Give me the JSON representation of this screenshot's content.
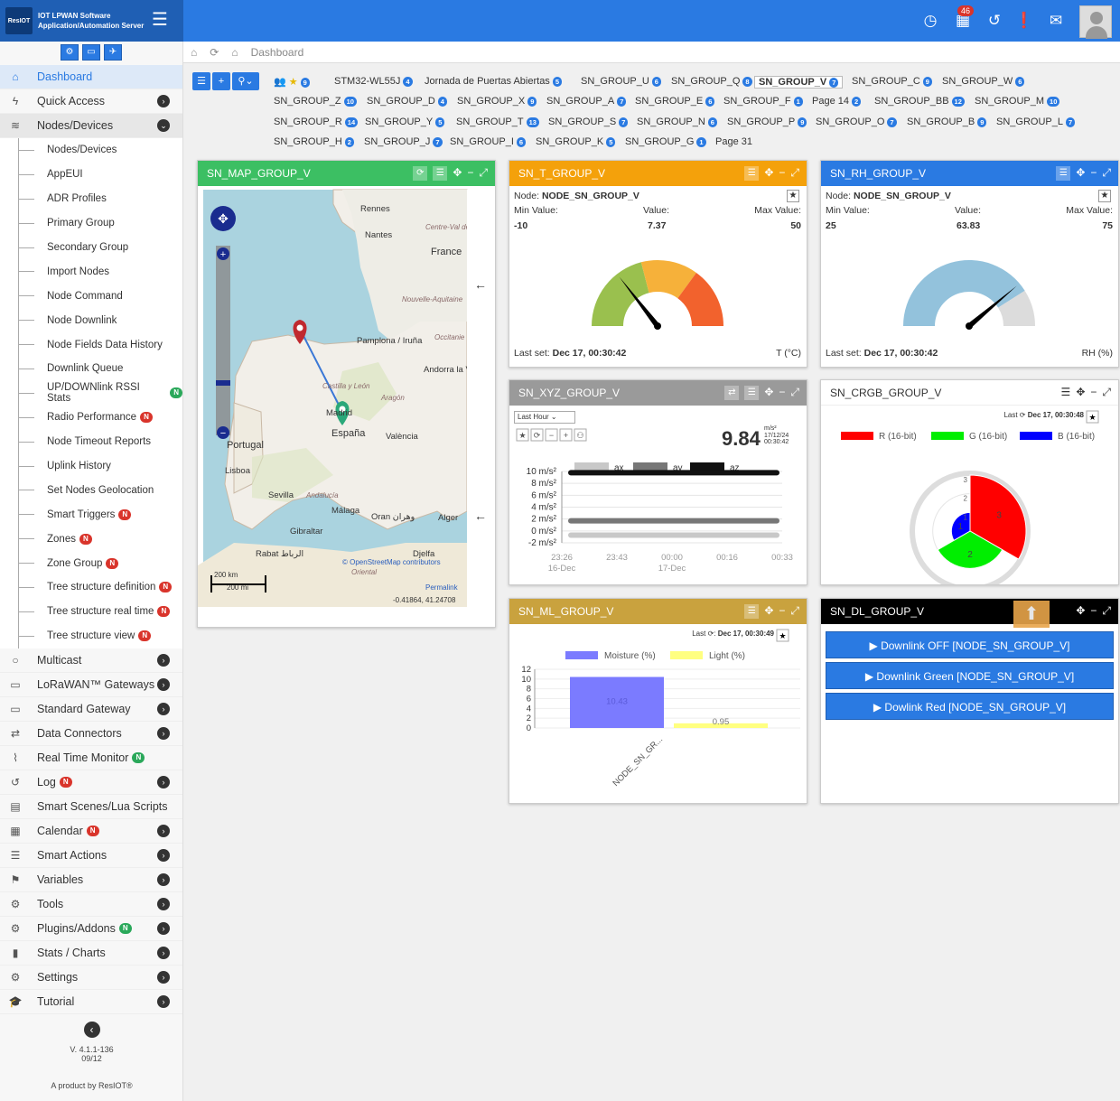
{
  "app": {
    "logo_mark": "ResIOT",
    "logo_text": "IOT LPWAN Software Application/Automation Server",
    "notifications_count": "46"
  },
  "breadcrumb": {
    "home": "Dashboard"
  },
  "sidebar": {
    "items": [
      {
        "label": "Dashboard",
        "icon": "home-icon"
      },
      {
        "label": "Quick Access",
        "icon": "bolt-icon"
      },
      {
        "label": "Nodes/Devices",
        "icon": "rss-icon"
      }
    ],
    "sub_items": [
      {
        "label": "Nodes/Devices",
        "badge": ""
      },
      {
        "label": "AppEUI",
        "badge": ""
      },
      {
        "label": "ADR Profiles",
        "badge": ""
      },
      {
        "label": "Primary Group",
        "badge": ""
      },
      {
        "label": "Secondary Group",
        "badge": ""
      },
      {
        "label": "Import Nodes",
        "badge": ""
      },
      {
        "label": "Node Command",
        "badge": ""
      },
      {
        "label": "Node Downlink",
        "badge": ""
      },
      {
        "label": "Node Fields Data History",
        "badge": ""
      },
      {
        "label": "Downlink Queue",
        "badge": ""
      },
      {
        "label": "UP/DOWNlink RSSI Stats",
        "badge": "N",
        "badge_color": "g"
      },
      {
        "label": "Radio Performance",
        "badge": "N",
        "badge_color": "r"
      },
      {
        "label": "Node Timeout Reports",
        "badge": ""
      },
      {
        "label": "Uplink History",
        "badge": ""
      },
      {
        "label": "Set Nodes Geolocation",
        "badge": ""
      },
      {
        "label": "Smart Triggers",
        "badge": "N",
        "badge_color": "r"
      },
      {
        "label": "Zones",
        "badge": "N",
        "badge_color": "r"
      },
      {
        "label": "Zone Group",
        "badge": "N",
        "badge_color": "r"
      },
      {
        "label": "Tree structure definition",
        "badge": "N",
        "badge_color": "r"
      },
      {
        "label": "Tree structure real time",
        "badge": "N",
        "badge_color": "r"
      },
      {
        "label": "Tree structure view",
        "badge": "N",
        "badge_color": "r"
      }
    ],
    "lower_items": [
      {
        "label": "Multicast",
        "badge": "",
        "arrow": true
      },
      {
        "label": "LoRaWAN™ Gateways",
        "badge": "",
        "arrow": true
      },
      {
        "label": "Standard Gateway",
        "badge": "",
        "arrow": true
      },
      {
        "label": "Data Connectors",
        "badge": "",
        "arrow": true
      },
      {
        "label": "Real Time Monitor",
        "badge": "N",
        "badge_color": "g",
        "arrow": false
      },
      {
        "label": "Log",
        "badge": "N",
        "badge_color": "r",
        "arrow": true
      },
      {
        "label": "Smart Scenes/Lua Scripts",
        "badge": "",
        "arrow": false
      },
      {
        "label": "Calendar",
        "badge": "N",
        "badge_color": "r",
        "arrow": true
      },
      {
        "label": "Smart Actions",
        "badge": "",
        "arrow": true
      },
      {
        "label": "Variables",
        "badge": "",
        "arrow": true
      },
      {
        "label": "Tools",
        "badge": "",
        "arrow": true
      },
      {
        "label": "Plugins/Addons",
        "badge": "N",
        "badge_color": "g",
        "arrow": true
      },
      {
        "label": "Stats / Charts",
        "badge": "",
        "arrow": true
      },
      {
        "label": "Settings",
        "badge": "",
        "arrow": true
      },
      {
        "label": "Tutorial",
        "badge": "",
        "arrow": true
      }
    ],
    "version": "V. 4.1.1-136",
    "version_date": "09/12",
    "product_by": "A product by ResIOT®"
  },
  "groups": {
    "star_count": "9",
    "rows": [
      [
        {
          "l": "STM32-WL55J",
          "n": "4"
        },
        {
          "l": "Jornada de Puertas Abiertas",
          "n": "5"
        },
        {
          "l": "SN_GROUP_U",
          "n": "6"
        },
        {
          "l": "SN_GROUP_Q",
          "n": "8"
        },
        {
          "l": "SN_GROUP_V",
          "n": "7",
          "sel": true
        },
        {
          "l": "SN_GROUP_C",
          "n": "9"
        },
        {
          "l": "SN_GROUP_W",
          "n": "6"
        }
      ],
      [
        {
          "l": "SN_GROUP_Z",
          "n": "10"
        },
        {
          "l": "SN_GROUP_D",
          "n": "4"
        },
        {
          "l": "SN_GROUP_X",
          "n": "9"
        },
        {
          "l": "SN_GROUP_A",
          "n": "7"
        },
        {
          "l": "SN_GROUP_E",
          "n": "6"
        },
        {
          "l": "SN_GROUP_F",
          "n": "1"
        },
        {
          "l": "Page 14",
          "n": "2"
        },
        {
          "l": "SN_GROUP_BB",
          "n": "12"
        },
        {
          "l": "SN_GROUP_M",
          "n": "10"
        }
      ],
      [
        {
          "l": "SN_GROUP_R",
          "n": "14"
        },
        {
          "l": "SN_GROUP_Y",
          "n": "5"
        },
        {
          "l": "SN_GROUP_T",
          "n": "13"
        },
        {
          "l": "SN_GROUP_S",
          "n": "7"
        },
        {
          "l": "SN_GROUP_N",
          "n": "6"
        },
        {
          "l": "SN_GROUP_P",
          "n": "9"
        },
        {
          "l": "SN_GROUP_O",
          "n": "7"
        },
        {
          "l": "SN_GROUP_B",
          "n": "9"
        },
        {
          "l": "SN_GROUP_L",
          "n": "7"
        }
      ],
      [
        {
          "l": "SN_GROUP_H",
          "n": "2"
        },
        {
          "l": "SN_GROUP_J",
          "n": "7"
        },
        {
          "l": "SN_GROUP_I",
          "n": "6"
        },
        {
          "l": "SN_GROUP_K",
          "n": "5"
        },
        {
          "l": "SN_GROUP_G",
          "n": "1"
        },
        {
          "l": "Page 31",
          "n": ""
        }
      ]
    ]
  },
  "map": {
    "title": "SN_MAP_GROUP_V",
    "scale_km": "200 km",
    "scale_mi": "200 mi",
    "coords": "-0.41864, 41.24708",
    "attribution": "© OpenStreetMap contributors",
    "permalink": "Permalink",
    "places": [
      {
        "t": "Rennes"
      },
      {
        "t": "Nantes"
      },
      {
        "t": "France"
      },
      {
        "t": "Centre-Val de Loire"
      },
      {
        "t": "Nouvelle-Aquitaine"
      },
      {
        "t": "Occitanie"
      },
      {
        "t": "Pamplona / Iruña"
      },
      {
        "t": "Andorra la Vella"
      },
      {
        "t": "Aragón"
      },
      {
        "t": "Castilla y León"
      },
      {
        "t": "Madrid"
      },
      {
        "t": "España"
      },
      {
        "t": "València"
      },
      {
        "t": "Portugal"
      },
      {
        "t": "Lisboa"
      },
      {
        "t": "Sevilla"
      },
      {
        "t": "Andalucía"
      },
      {
        "t": "Málaga"
      },
      {
        "t": "Gibraltar"
      },
      {
        "t": "Oran وهران"
      },
      {
        "t": "Alger"
      },
      {
        "t": "Rabat الرباط"
      },
      {
        "t": "Djelfa"
      },
      {
        "t": "Oriental"
      }
    ]
  },
  "t_gauge": {
    "title": "SN_T_GROUP_V",
    "node_label": "Node:",
    "node": "NODE_SN_GROUP_V",
    "min_label": "Min Value:",
    "value_label": "Value:",
    "max_label": "Max Value:",
    "min": "-10",
    "value": "7.37",
    "max": "50",
    "last_set_label": "Last set:",
    "last_set": "Dec 17, 00:30:42",
    "unit": "T (°C)",
    "value_num": 7.37,
    "min_num": -10,
    "max_num": 50
  },
  "rh_gauge": {
    "title": "SN_RH_GROUP_V",
    "node_label": "Node:",
    "node": "NODE_SN_GROUP_V",
    "min_label": "Min Value:",
    "value_label": "Value:",
    "max_label": "Max Value:",
    "min": "25",
    "value": "63.83",
    "max": "75",
    "last_set_label": "Last set:",
    "last_set": "Dec 17, 00:30:42",
    "unit": "RH (%)",
    "value_num": 63.83,
    "min_num": 25,
    "max_num": 75
  },
  "xyz": {
    "title": "SN_XYZ_GROUP_V",
    "range": "Last Hour",
    "value": "9.84",
    "unit": "m/s²",
    "date": "17/12/24",
    "time": "00:30:42"
  },
  "crgb": {
    "title": "SN_CRGB_GROUP_V",
    "last_label": "Last",
    "last": "Dec 17, 00:30:48"
  },
  "ml": {
    "title": "SN_ML_GROUP_V",
    "last_label": "Last",
    "last": "Dec 17, 00:30:49"
  },
  "dl": {
    "title": "SN_DL_GROUP_V",
    "buttons": [
      "Downlink OFF [NODE_SN_GROUP_V]",
      "Downlink Green [NODE_SN_GROUP_V]",
      "Dowlink Red [NODE_SN_GROUP_V]"
    ]
  },
  "chart_data": [
    {
      "type": "line",
      "title": "SN_XYZ_GROUP_V",
      "ylabel": "",
      "yticks": [
        "10 m/s²",
        "8 m/s²",
        "6 m/s²",
        "4 m/s²",
        "2 m/s²",
        "0 m/s²",
        "-2 m/s²"
      ],
      "ylim": [
        -2,
        10
      ],
      "xticks": [
        "23:26 16-Dec",
        "23:43",
        "00:00 17-Dec",
        "00:16",
        "00:33"
      ],
      "series": [
        {
          "name": "ax",
          "color": "#c8c8c8",
          "values": [
            -0.7,
            -0.7,
            -0.7,
            -0.7,
            -0.7
          ]
        },
        {
          "name": "ay",
          "color": "#777777",
          "values": [
            1.7,
            1.7,
            1.7,
            1.7,
            1.7
          ]
        },
        {
          "name": "az",
          "color": "#111111",
          "values": [
            9.8,
            9.8,
            9.8,
            9.8,
            9.8
          ]
        }
      ]
    },
    {
      "type": "pie",
      "title": "SN_CRGB_GROUP_V",
      "categories": [
        "R (16-bit)",
        "G (16-bit)",
        "B (16-bit)"
      ],
      "values": [
        3,
        2,
        1
      ],
      "colors": [
        "#ff0000",
        "#00ee00",
        "#0000ff"
      ],
      "rticks": [
        "3",
        "2",
        "1"
      ]
    },
    {
      "type": "bar",
      "title": "SN_ML_GROUP_V",
      "categories": [
        "NODE_SN_GR..."
      ],
      "series": [
        {
          "name": "Moisture (%)",
          "color": "#7b7bff",
          "values": [
            10.43
          ]
        },
        {
          "name": "Light (%)",
          "color": "#ffff80",
          "values": [
            0.95
          ]
        }
      ],
      "yticks": [
        "12",
        "10",
        "8",
        "6",
        "4",
        "2",
        "0"
      ],
      "ylim": [
        0,
        12
      ]
    }
  ]
}
